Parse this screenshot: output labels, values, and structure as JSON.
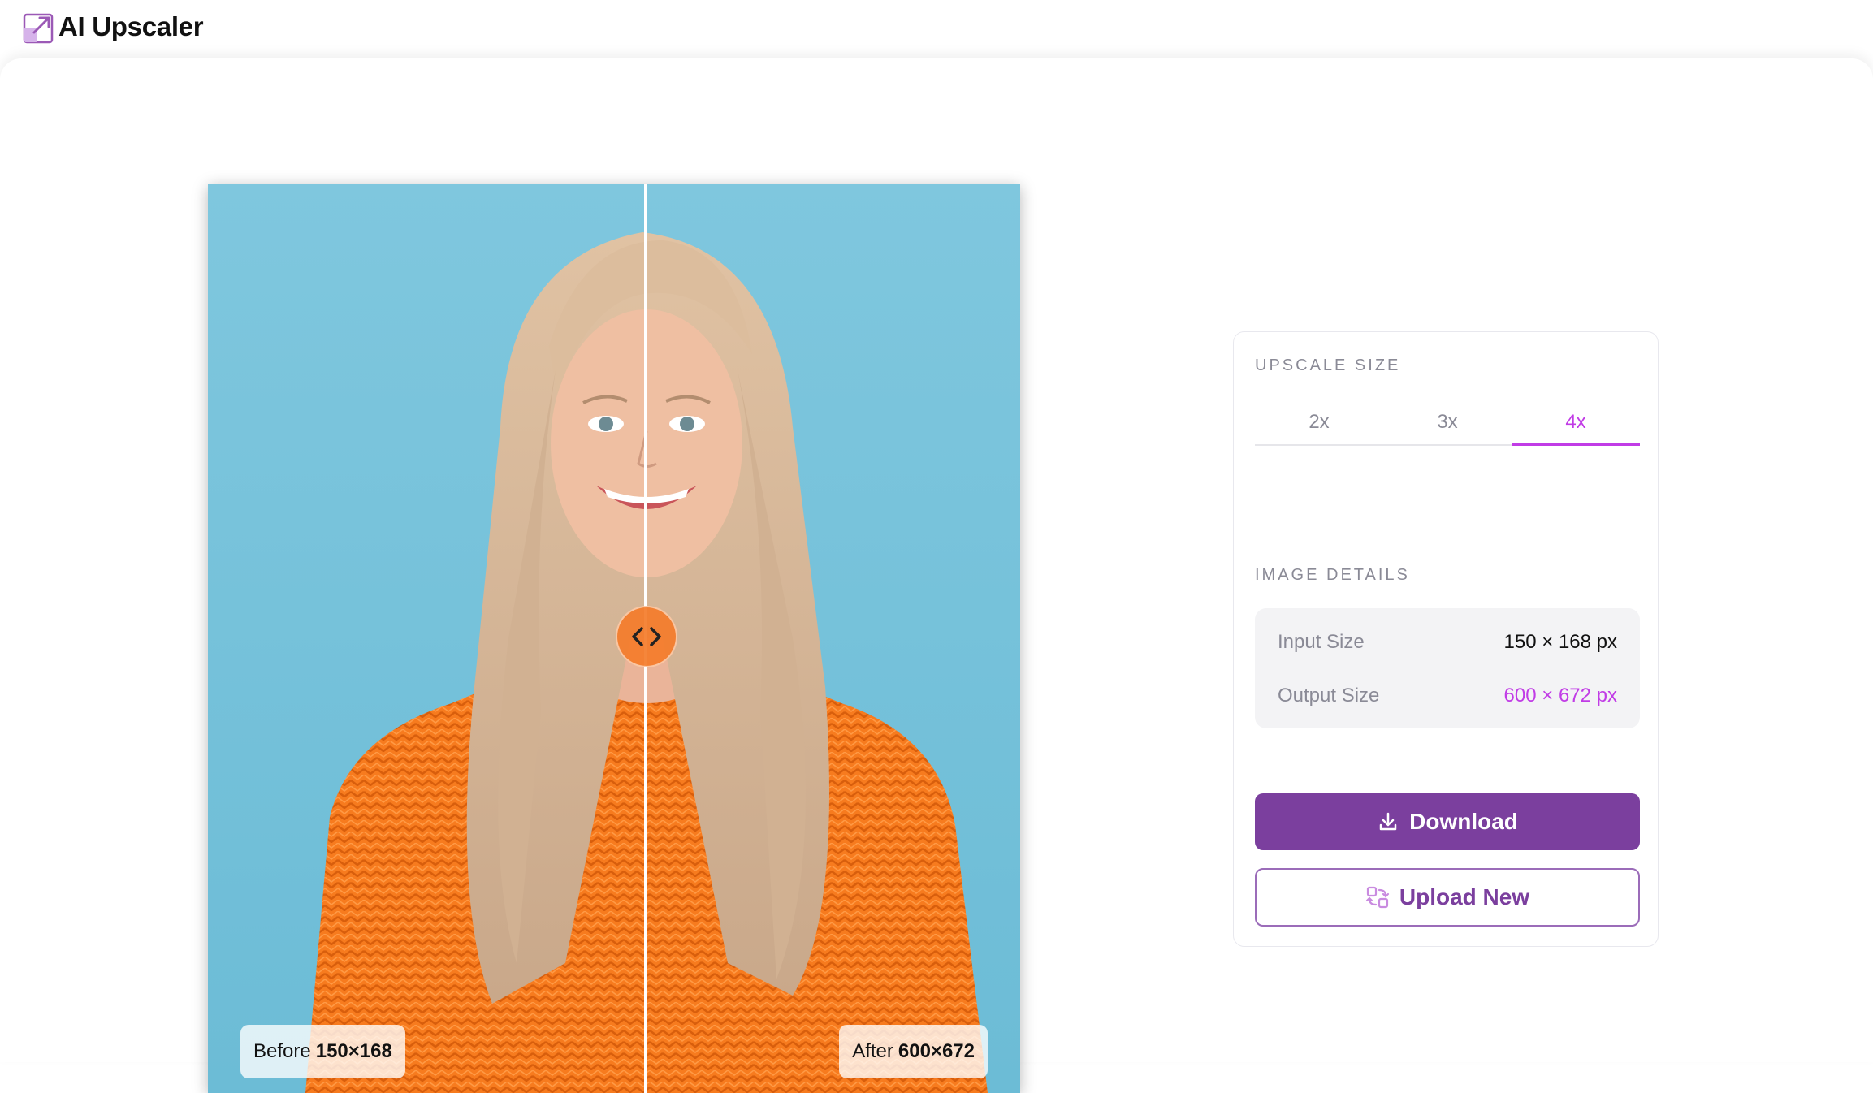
{
  "app": {
    "title": "AI Upscaler"
  },
  "compare": {
    "before_label": "Before",
    "before_size": "150×168",
    "after_label": "After",
    "after_size": "600×672"
  },
  "panel": {
    "upscale_heading": "UPSCALE SIZE",
    "scales": [
      {
        "label": "2x",
        "selected": false
      },
      {
        "label": "3x",
        "selected": false
      },
      {
        "label": "4x",
        "selected": true
      }
    ],
    "details_heading": "IMAGE DETAILS",
    "input_size_label": "Input Size",
    "input_size_value": "150 × 168 px",
    "output_size_label": "Output Size",
    "output_size_value": "600 × 672 px",
    "download_label": "Download",
    "upload_label": "Upload New"
  },
  "icons": {
    "logo": "expand-arrow-icon",
    "handle": "compare-arrows-icon",
    "download": "download-icon",
    "upload": "replace-image-icon"
  },
  "colors": {
    "accent": "#c13ce6",
    "primary": "#7b3f9e",
    "handle": "#f47c2a"
  }
}
